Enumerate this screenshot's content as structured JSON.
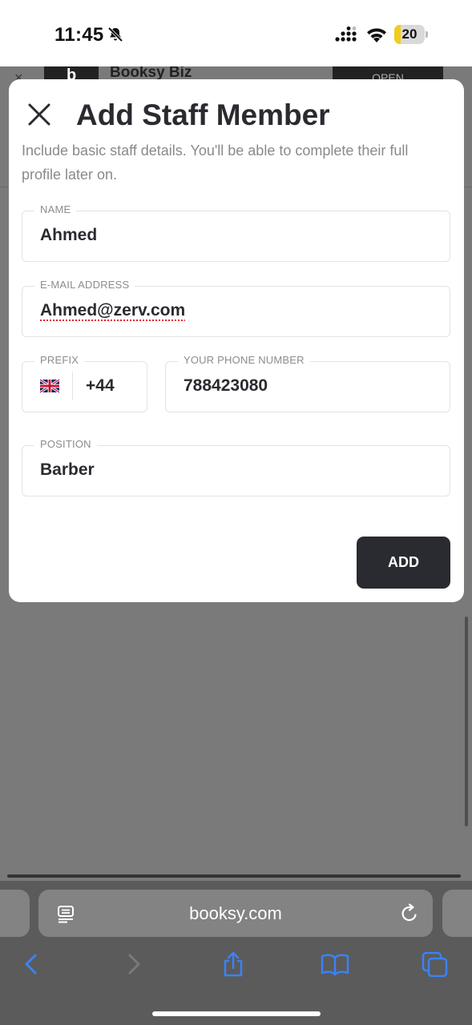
{
  "status_bar": {
    "time": "11:45",
    "battery": "20",
    "battery_level": 0.2
  },
  "banner": {
    "title": "Booksy Biz",
    "open_label": "OPEN"
  },
  "modal": {
    "title": "Add Staff Member",
    "description": "Include basic staff details. You'll be able to complete their full profile later on.",
    "fields": {
      "name": {
        "label": "NAME",
        "value": "Ahmed"
      },
      "email": {
        "label": "E-MAIL ADDRESS",
        "value": "Ahmed@zerv.com"
      },
      "prefix": {
        "label": "PREFIX",
        "value": "+44"
      },
      "phone": {
        "label": "YOUR PHONE NUMBER",
        "value": "788423080"
      },
      "position": {
        "label": "POSITION",
        "value": "Barber"
      }
    },
    "add_label": "ADD"
  },
  "browser": {
    "url": "booksy.com"
  },
  "colors": {
    "accent_dark": "#2a2b30",
    "toolbar_icon": "#3b82f6",
    "battery_yellow": "#f2cc1a"
  },
  "icons": [
    "bell-slash-icon",
    "cellular-signal-icon",
    "wifi-icon",
    "close-icon",
    "uk-flag-icon",
    "reader-icon",
    "reload-icon",
    "back-icon",
    "forward-icon",
    "share-icon",
    "bookmarks-icon",
    "tabs-icon"
  ]
}
